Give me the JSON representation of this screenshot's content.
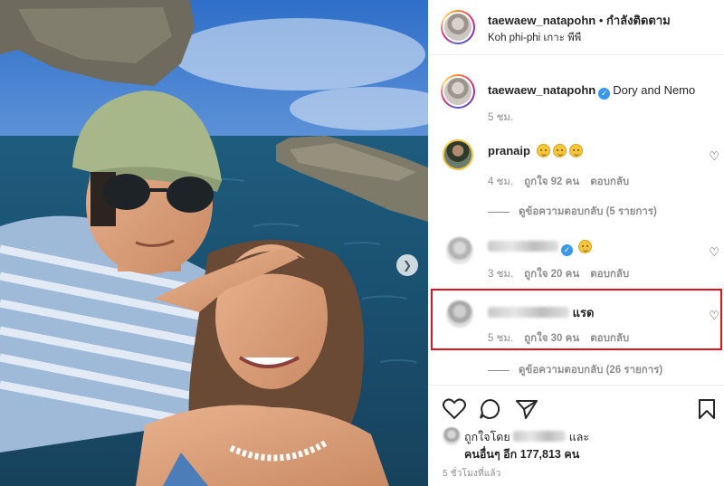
{
  "header": {
    "username": "taewaew_natapohn",
    "separator": "•",
    "follow_status": "กำลังติดตาม",
    "location": "Koh phi-phi เกาะ พีพี"
  },
  "caption": {
    "username": "taewaew_natapohn",
    "text": "Dory and Nemo",
    "time": "5 ชม."
  },
  "comments": [
    {
      "username": "pranaip",
      "emoji_count": 3,
      "time": "4 ชม.",
      "likes": "ถูกใจ 92 คน",
      "reply": "ตอบกลับ",
      "view_replies": "ดูข้อความตอบกลับ (5 รายการ)"
    },
    {
      "username_blurred": true,
      "emoji_count": 1,
      "time": "3 ชม.",
      "likes": "ถูกใจ 20 คน",
      "reply": "ตอบกลับ"
    },
    {
      "username_blurred": true,
      "text": "แรด",
      "time": "5 ชม.",
      "likes": "ถูกใจ 30 คน",
      "reply": "ตอบกลับ",
      "view_replies": "ดูข้อความตอบกลับ (26 รายการ)"
    }
  ],
  "likes_summary": {
    "prefix": "ถูกใจโดย",
    "suffix": "และ",
    "others": "คนอื่นๆ อีก 177,813 คน"
  },
  "post_time": "5 ชั่วโมงที่แล้ว",
  "colors": {
    "highlight_border": "#e0121f",
    "verified": "#3897f0",
    "muted_text": "#8e8e8e"
  },
  "icons": [
    "heart-icon",
    "comment-icon",
    "share-icon",
    "bookmark-icon",
    "chevron-right-icon",
    "verified-badge-icon"
  ]
}
